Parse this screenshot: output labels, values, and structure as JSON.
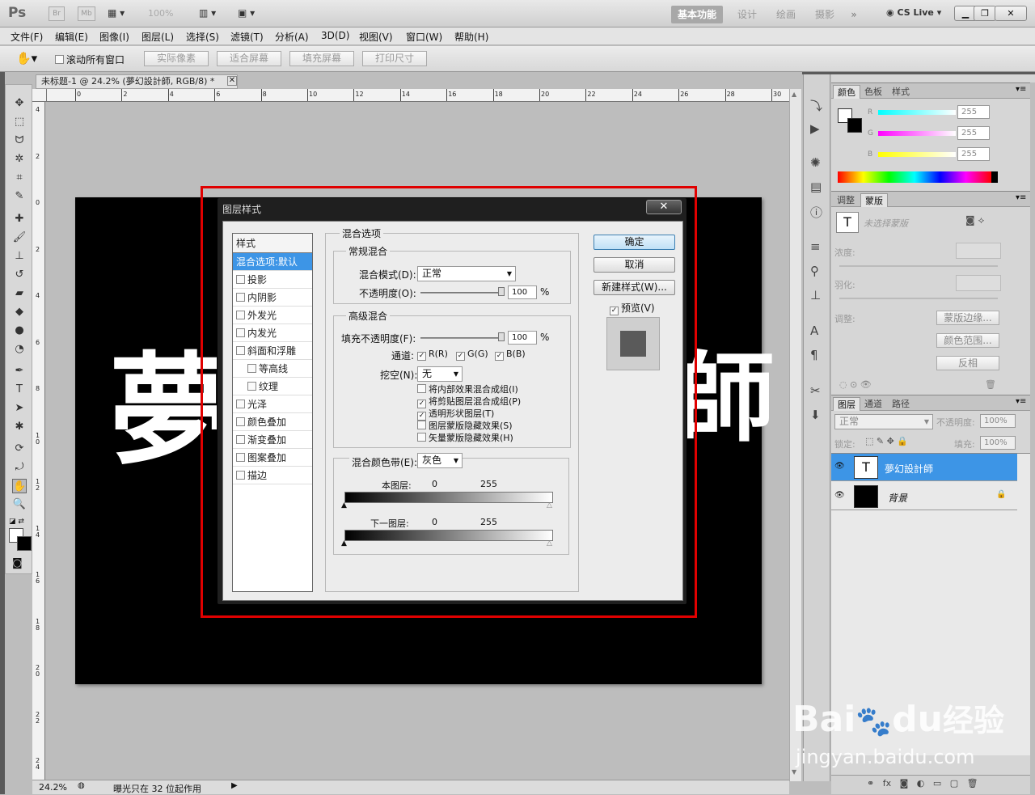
{
  "app": {
    "logo": "Ps",
    "br": "Br",
    "mb": "Mb",
    "zoom": "100%"
  },
  "workspaces": [
    "基本功能",
    "设计",
    "绘画",
    "摄影"
  ],
  "cslive": "CS Live",
  "menus": [
    "文件(F)",
    "编辑(E)",
    "图像(I)",
    "图层(L)",
    "选择(S)",
    "滤镜(T)",
    "分析(A)",
    "3D(D)",
    "视图(V)",
    "窗口(W)",
    "帮助(H)"
  ],
  "options": {
    "scroll_all": "滚动所有窗口",
    "actual_pixels": "实际像素",
    "fit_screen": "适合屏幕",
    "fill_screen": "填充屏幕",
    "print_size": "打印尺寸"
  },
  "document": {
    "tab_title": "未标题-1 @ 24.2% (夢幻設計師, RGB/8) *",
    "canvas_char_left": "夢",
    "canvas_char_right": "師",
    "zoom": "24.2%",
    "status_text": "曝光只在 32 位起作用"
  },
  "ruler_top": [
    "0",
    "2",
    "4",
    "6",
    "8",
    "10",
    "12",
    "14",
    "16",
    "18",
    "20",
    "22",
    "24",
    "26",
    "28",
    "30"
  ],
  "ruler_left": [
    "4",
    "2",
    "0",
    "2",
    "4",
    "6",
    "8",
    "1\n0",
    "1\n2",
    "1\n4",
    "1\n6",
    "1\n8",
    "2\n0",
    "2\n2",
    "2\n4"
  ],
  "dialog": {
    "title": "图层样式",
    "styles_header": "样式",
    "styles": [
      {
        "label": "混合选项:默认",
        "checkbox": false,
        "selected": true
      },
      {
        "label": "投影",
        "checkbox": true
      },
      {
        "label": "内阴影",
        "checkbox": true
      },
      {
        "label": "外发光",
        "checkbox": true
      },
      {
        "label": "内发光",
        "checkbox": true
      },
      {
        "label": "斜面和浮雕",
        "checkbox": true
      },
      {
        "label": "等高线",
        "checkbox": true,
        "indent": true
      },
      {
        "label": "纹理",
        "checkbox": true,
        "indent": true
      },
      {
        "label": "光泽",
        "checkbox": true
      },
      {
        "label": "颜色叠加",
        "checkbox": true
      },
      {
        "label": "渐变叠加",
        "checkbox": true
      },
      {
        "label": "图案叠加",
        "checkbox": true
      },
      {
        "label": "描边",
        "checkbox": true
      }
    ],
    "blend_options": "混合选项",
    "general_blend": "常规混合",
    "blend_mode_label": "混合模式(D):",
    "blend_mode_value": "正常",
    "opacity_label": "不透明度(O):",
    "opacity_value": "100",
    "percent": "%",
    "advanced_blend": "高级混合",
    "fill_opacity_label": "填充不透明度(F):",
    "fill_opacity_value": "100",
    "channels_label": "通道:",
    "channel_r": "R(R)",
    "channel_g": "G(G)",
    "channel_b": "B(B)",
    "knockout_label": "挖空(N):",
    "knockout_value": "无",
    "opt1": "将内部效果混合成组(I)",
    "opt2": "将剪贴图层混合成组(P)",
    "opt3": "透明形状图层(T)",
    "opt4": "图层蒙版隐藏效果(S)",
    "opt5": "矢量蒙版隐藏效果(H)",
    "opt_checked": [
      false,
      true,
      true,
      false,
      false
    ],
    "blend_if_label": "混合颜色带(E):",
    "blend_if_value": "灰色",
    "this_layer": "本图层:",
    "underlying": "下一图层:",
    "min": "0",
    "max": "255",
    "ok": "确定",
    "cancel": "取消",
    "new_style": "新建样式(W)...",
    "preview": "预览(V)"
  },
  "color_panel": {
    "tabs": [
      "颜色",
      "色板",
      "样式"
    ],
    "r_label": "R",
    "g_label": "G",
    "b_label": "B",
    "r": "255",
    "g": "255",
    "b": "255"
  },
  "mask_panel": {
    "tabs": [
      "调整",
      "蒙版"
    ],
    "no_mask": "未选择蒙版",
    "density": "浓度:",
    "feather": "羽化:",
    "refine": "调整:",
    "mask_edge": "蒙版边缘...",
    "color_range": "颜色范围...",
    "invert": "反相"
  },
  "layers_panel": {
    "tabs": [
      "图层",
      "通道",
      "路径"
    ],
    "blend_mode": "正常",
    "opacity_label": "不透明度:",
    "opacity": "100%",
    "lock_label": "锁定:",
    "fill_label": "填充:",
    "fill": "100%",
    "layers": [
      {
        "name": "夢幻設計師",
        "type": "T",
        "selected": true
      },
      {
        "name": "背景",
        "type": "bg",
        "selected": false
      }
    ]
  },
  "watermark": {
    "brand": "Bai",
    "du": "du",
    "jingyan": "经验",
    "url": "jingyan.baidu.com"
  },
  "colors": {
    "accent": "#3d95e6",
    "highlight": "#e00000"
  }
}
